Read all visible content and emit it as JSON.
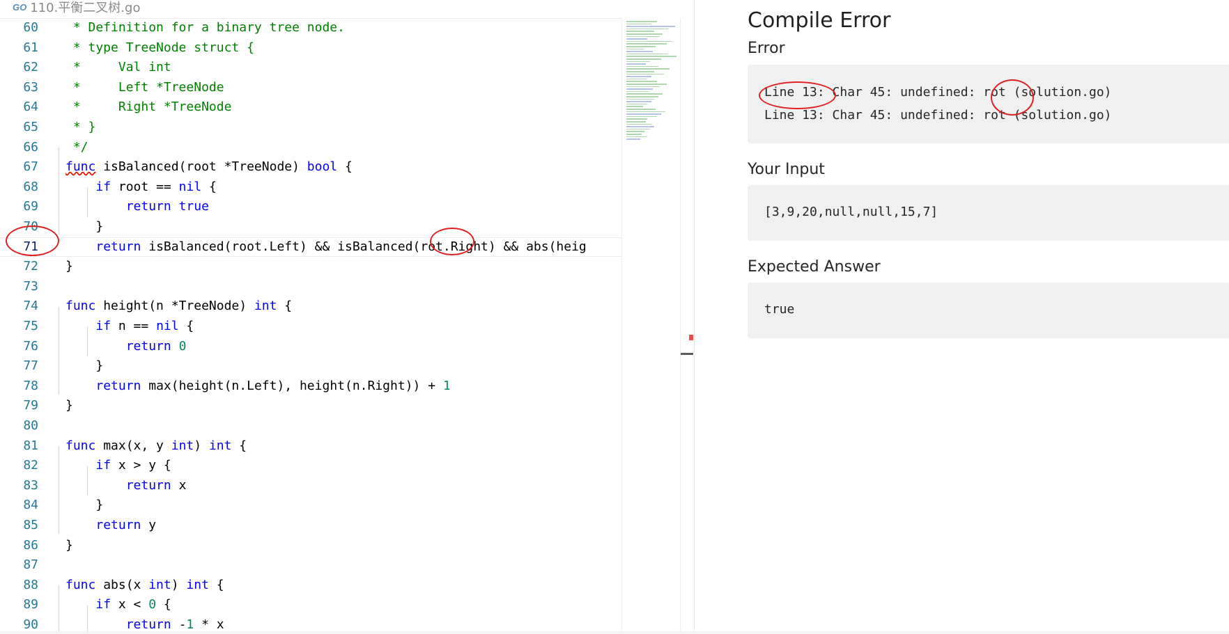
{
  "editor": {
    "tab": {
      "icon": "go-icon",
      "icon_text": "GO",
      "filename": "110.平衡二叉树.go"
    },
    "lines": [
      {
        "no": "60",
        "tokens": [
          [
            "cm",
            " * Definition for a binary tree node."
          ]
        ]
      },
      {
        "no": "61",
        "tokens": [
          [
            "cm",
            " * type TreeNode struct {"
          ]
        ]
      },
      {
        "no": "62",
        "tokens": [
          [
            "cm",
            " *     Val int"
          ]
        ]
      },
      {
        "no": "63",
        "tokens": [
          [
            "cm",
            " *     Left *TreeNode"
          ]
        ]
      },
      {
        "no": "64",
        "tokens": [
          [
            "cm",
            " *     Right *TreeNode"
          ]
        ]
      },
      {
        "no": "65",
        "tokens": [
          [
            "cm",
            " * }"
          ]
        ]
      },
      {
        "no": "66",
        "tokens": [
          [
            "cm",
            " */"
          ]
        ]
      },
      {
        "no": "67",
        "tokens": [
          [
            "kwerr",
            "func"
          ],
          [
            "tx",
            " isBalanced(root *TreeNode) "
          ],
          [
            "kw",
            "bool"
          ],
          [
            "tx",
            " {"
          ]
        ]
      },
      {
        "no": "68",
        "tokens": [
          [
            "tx",
            "    "
          ],
          [
            "kw",
            "if"
          ],
          [
            "tx",
            " root == "
          ],
          [
            "kw",
            "nil"
          ],
          [
            "tx",
            " {"
          ]
        ]
      },
      {
        "no": "69",
        "tokens": [
          [
            "tx",
            "        "
          ],
          [
            "kw",
            "return"
          ],
          [
            "tx",
            " "
          ],
          [
            "kw",
            "true"
          ]
        ]
      },
      {
        "no": "70",
        "tokens": [
          [
            "tx",
            "    }"
          ]
        ]
      },
      {
        "no": "71",
        "current": true,
        "tokens": [
          [
            "tx",
            "    "
          ],
          [
            "kw",
            "return"
          ],
          [
            "tx",
            " isBalanced(root.Left) && isBalanced(rot.Right) && abs(heig"
          ]
        ]
      },
      {
        "no": "72",
        "tokens": [
          [
            "tx",
            "}"
          ]
        ]
      },
      {
        "no": "73",
        "tokens": [
          [
            "tx",
            ""
          ]
        ]
      },
      {
        "no": "74",
        "tokens": [
          [
            "kw",
            "func"
          ],
          [
            "tx",
            " height(n *TreeNode) "
          ],
          [
            "kw",
            "int"
          ],
          [
            "tx",
            " {"
          ]
        ]
      },
      {
        "no": "75",
        "tokens": [
          [
            "tx",
            "    "
          ],
          [
            "kw",
            "if"
          ],
          [
            "tx",
            " n == "
          ],
          [
            "kw",
            "nil"
          ],
          [
            "tx",
            " {"
          ]
        ]
      },
      {
        "no": "76",
        "tokens": [
          [
            "tx",
            "        "
          ],
          [
            "kw",
            "return"
          ],
          [
            "tx",
            " "
          ],
          [
            "num",
            "0"
          ]
        ]
      },
      {
        "no": "77",
        "tokens": [
          [
            "tx",
            "    }"
          ]
        ]
      },
      {
        "no": "78",
        "tokens": [
          [
            "tx",
            "    "
          ],
          [
            "kw",
            "return"
          ],
          [
            "tx",
            " max(height(n.Left), height(n.Right)) + "
          ],
          [
            "num",
            "1"
          ]
        ]
      },
      {
        "no": "79",
        "tokens": [
          [
            "tx",
            "}"
          ]
        ]
      },
      {
        "no": "80",
        "tokens": [
          [
            "tx",
            ""
          ]
        ]
      },
      {
        "no": "81",
        "tokens": [
          [
            "kw",
            "func"
          ],
          [
            "tx",
            " max(x, y "
          ],
          [
            "kw",
            "int"
          ],
          [
            "tx",
            ") "
          ],
          [
            "kw",
            "int"
          ],
          [
            "tx",
            " {"
          ]
        ]
      },
      {
        "no": "82",
        "tokens": [
          [
            "tx",
            "    "
          ],
          [
            "kw",
            "if"
          ],
          [
            "tx",
            " x > y {"
          ]
        ]
      },
      {
        "no": "83",
        "tokens": [
          [
            "tx",
            "        "
          ],
          [
            "kw",
            "return"
          ],
          [
            "tx",
            " x"
          ]
        ]
      },
      {
        "no": "84",
        "tokens": [
          [
            "tx",
            "    }"
          ]
        ]
      },
      {
        "no": "85",
        "tokens": [
          [
            "tx",
            "    "
          ],
          [
            "kw",
            "return"
          ],
          [
            "tx",
            " y"
          ]
        ]
      },
      {
        "no": "86",
        "tokens": [
          [
            "tx",
            "}"
          ]
        ]
      },
      {
        "no": "87",
        "tokens": [
          [
            "tx",
            ""
          ]
        ]
      },
      {
        "no": "88",
        "tokens": [
          [
            "kw",
            "func"
          ],
          [
            "tx",
            " abs(x "
          ],
          [
            "kw",
            "int"
          ],
          [
            "tx",
            ") "
          ],
          [
            "kw",
            "int"
          ],
          [
            "tx",
            " {"
          ]
        ]
      },
      {
        "no": "89",
        "tokens": [
          [
            "tx",
            "    "
          ],
          [
            "kw",
            "if"
          ],
          [
            "tx",
            " x < "
          ],
          [
            "num",
            "0"
          ],
          [
            "tx",
            " {"
          ]
        ]
      },
      {
        "no": "90",
        "tokens": [
          [
            "tx",
            "        "
          ],
          [
            "kw",
            "return"
          ],
          [
            "tx",
            " -"
          ],
          [
            "num",
            "1"
          ],
          [
            "tx",
            " * x"
          ]
        ]
      }
    ]
  },
  "result": {
    "title": "Compile Error",
    "error_label": "Error",
    "error_lines": [
      "Line 13: Char 45: undefined: rot (solution.go)",
      "Line 13: Char 45: undefined: rot (solution.go)"
    ],
    "input_label": "Your Input",
    "input_value": "[3,9,20,null,null,15,7]",
    "expected_label": "Expected Answer",
    "expected_value": "true"
  },
  "colors": {
    "keyword": "#0000ff",
    "comment": "#008000",
    "number": "#098658",
    "line_number": "#237893",
    "annotation": "#e02020",
    "result_box": "#f0f0f0"
  }
}
